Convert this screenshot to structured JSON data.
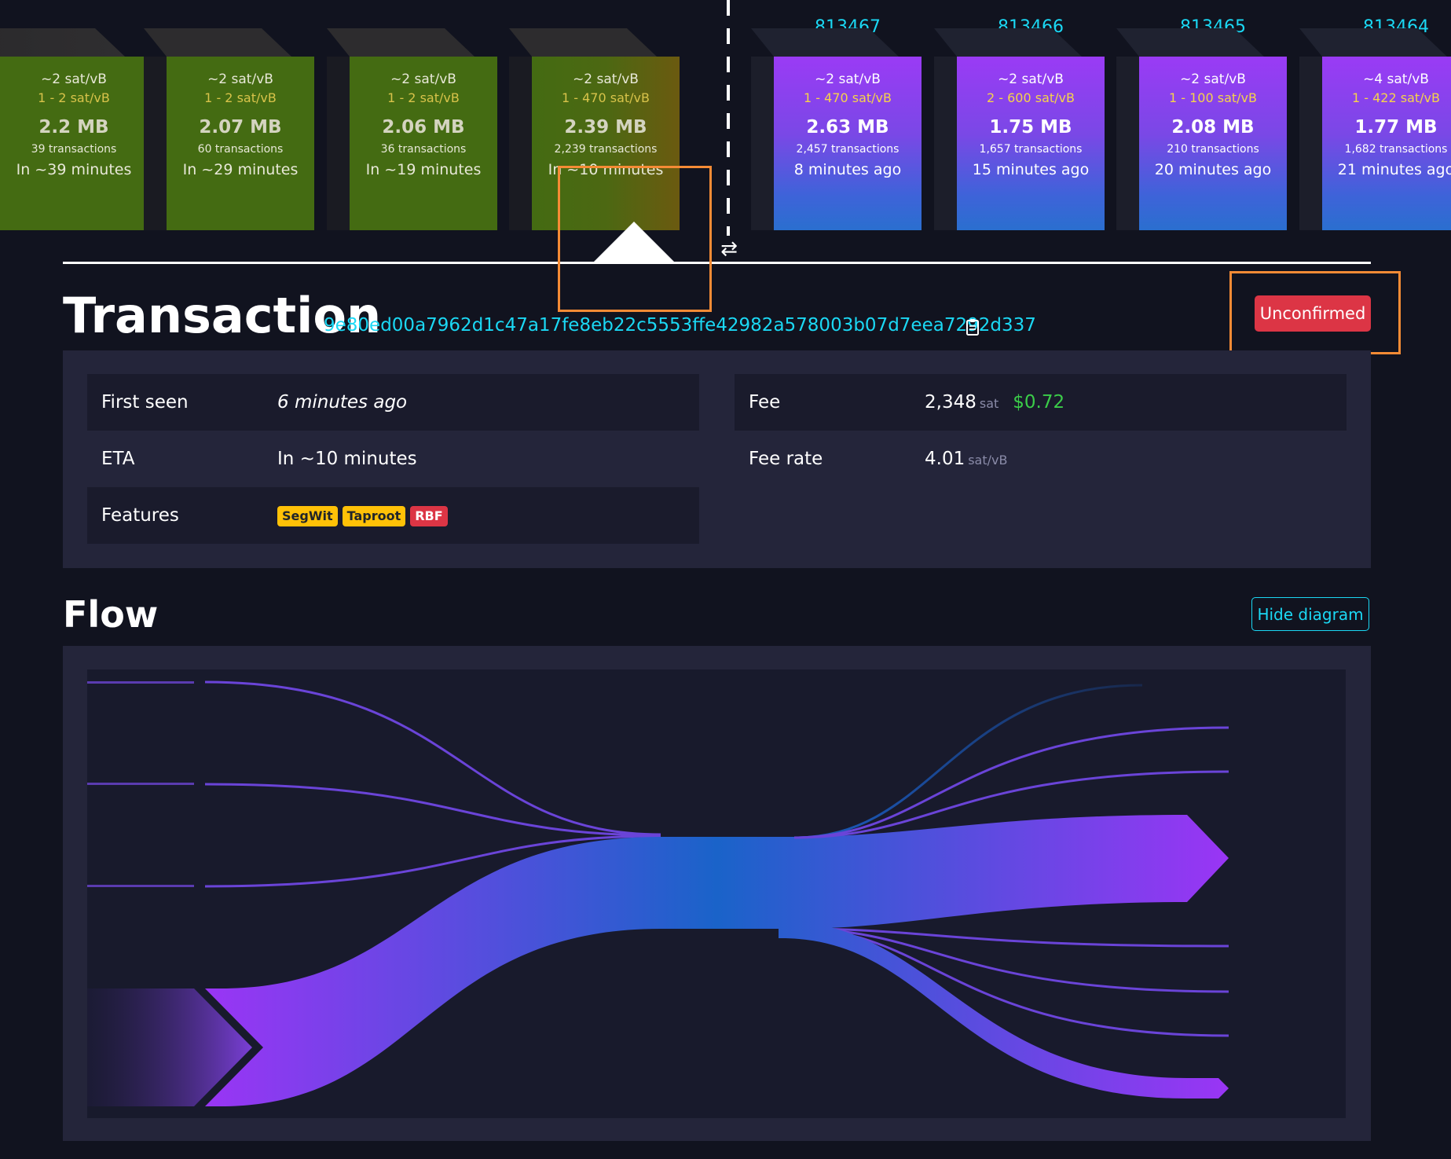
{
  "mempool_blocks": [
    {
      "median_fee": "~2 sat/vB",
      "fee_range": "1 - 2 sat/vB",
      "size": "2.2 MB",
      "tx_count": "39 transactions",
      "eta": "In ~39 minutes"
    },
    {
      "median_fee": "~2 sat/vB",
      "fee_range": "1 - 2 sat/vB",
      "size": "2.07 MB",
      "tx_count": "60 transactions",
      "eta": "In ~29 minutes"
    },
    {
      "median_fee": "~2 sat/vB",
      "fee_range": "1 - 2 sat/vB",
      "size": "2.06 MB",
      "tx_count": "36 transactions",
      "eta": "In ~19 minutes"
    },
    {
      "median_fee": "~2 sat/vB",
      "fee_range": "1 - 470 sat/vB",
      "size": "2.39 MB",
      "tx_count": "2,239 transactions",
      "eta": "In ~10 minutes"
    }
  ],
  "mined_blocks": [
    {
      "height": "813467",
      "median_fee": "~2 sat/vB",
      "fee_range": "1 - 470 sat/vB",
      "size": "2.63 MB",
      "tx_count": "2,457 transactions",
      "age": "8 minutes ago"
    },
    {
      "height": "813466",
      "median_fee": "~2 sat/vB",
      "fee_range": "2 - 600 sat/vB",
      "size": "1.75 MB",
      "tx_count": "1,657 transactions",
      "age": "15 minutes ago"
    },
    {
      "height": "813465",
      "median_fee": "~2 sat/vB",
      "fee_range": "1 - 100 sat/vB",
      "size": "2.08 MB",
      "tx_count": "210 transactions",
      "age": "20 minutes ago"
    },
    {
      "height": "813464",
      "median_fee": "~4 sat/vB",
      "fee_range": "1 - 422 sat/vB",
      "size": "1.77 MB",
      "tx_count": "1,682 transactions",
      "age": "21 minutes ago"
    }
  ],
  "transaction": {
    "heading": "Transaction",
    "txid": "9e80ed00a7962d1c47a17fe8eb22c5553ffe42982a578003b07d7eea7292d337",
    "status": "Unconfirmed",
    "first_seen_label": "First seen",
    "first_seen_value": "6 minutes ago",
    "eta_label": "ETA",
    "eta_value": "In ~10 minutes",
    "features_label": "Features",
    "features": [
      "SegWit",
      "Taproot",
      "RBF"
    ],
    "fee_label": "Fee",
    "fee_value": "2,348",
    "fee_unit": "sat",
    "fee_usd": "$0.72",
    "fee_rate_label": "Fee rate",
    "fee_rate_value": "4.01",
    "fee_rate_unit": "sat/vB"
  },
  "flow": {
    "heading": "Flow",
    "hide_button": "Hide diagram"
  },
  "colors": {
    "accent": "#1bd8f4",
    "unconfirmed": "#dc3545",
    "usd": "#3bcc49",
    "highlight": "#f58b35"
  }
}
